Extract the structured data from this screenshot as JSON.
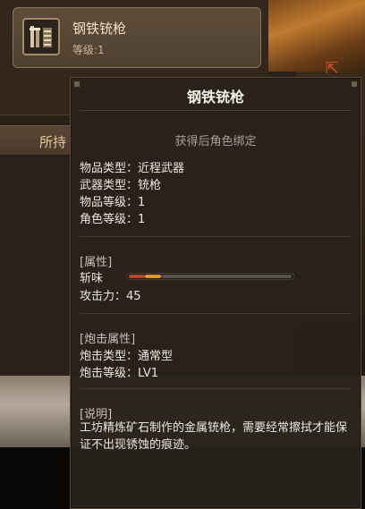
{
  "item_card": {
    "name": "钢铁铳枪",
    "level_text": "等级:1"
  },
  "background_tab": {
    "label": "所持"
  },
  "tooltip": {
    "title": "钢铁铳枪",
    "bind_note": "获得后角色绑定",
    "info": [
      "物品类型：近程武器",
      "武器类型：铳枪",
      "物品等级：1",
      "角色等级：1"
    ],
    "attributes": {
      "header": "[属性]",
      "element_label": "斩味",
      "sharpness_red_fraction": 0.1,
      "sharpness_orange_fraction": 0.1,
      "attack_line": "攻击力：45"
    },
    "shelling": {
      "header": "[炮击属性]",
      "type_line": "炮击类型：通常型",
      "level_line": "炮击等级：LV1"
    },
    "description": {
      "header": "[说明]",
      "text": "工坊精炼矿石制作的金属铳枪，需要经常擦拭才能保证不出现锈蚀的痕迹。"
    }
  },
  "colors": {
    "sharpness_red": "#c4432f",
    "sharpness_orange": "#d99a2a",
    "tooltip_bg": "#28221c"
  },
  "icons": {
    "item_icon": "gunlance-icon",
    "corner_icon": "corner-arrow-icon"
  }
}
